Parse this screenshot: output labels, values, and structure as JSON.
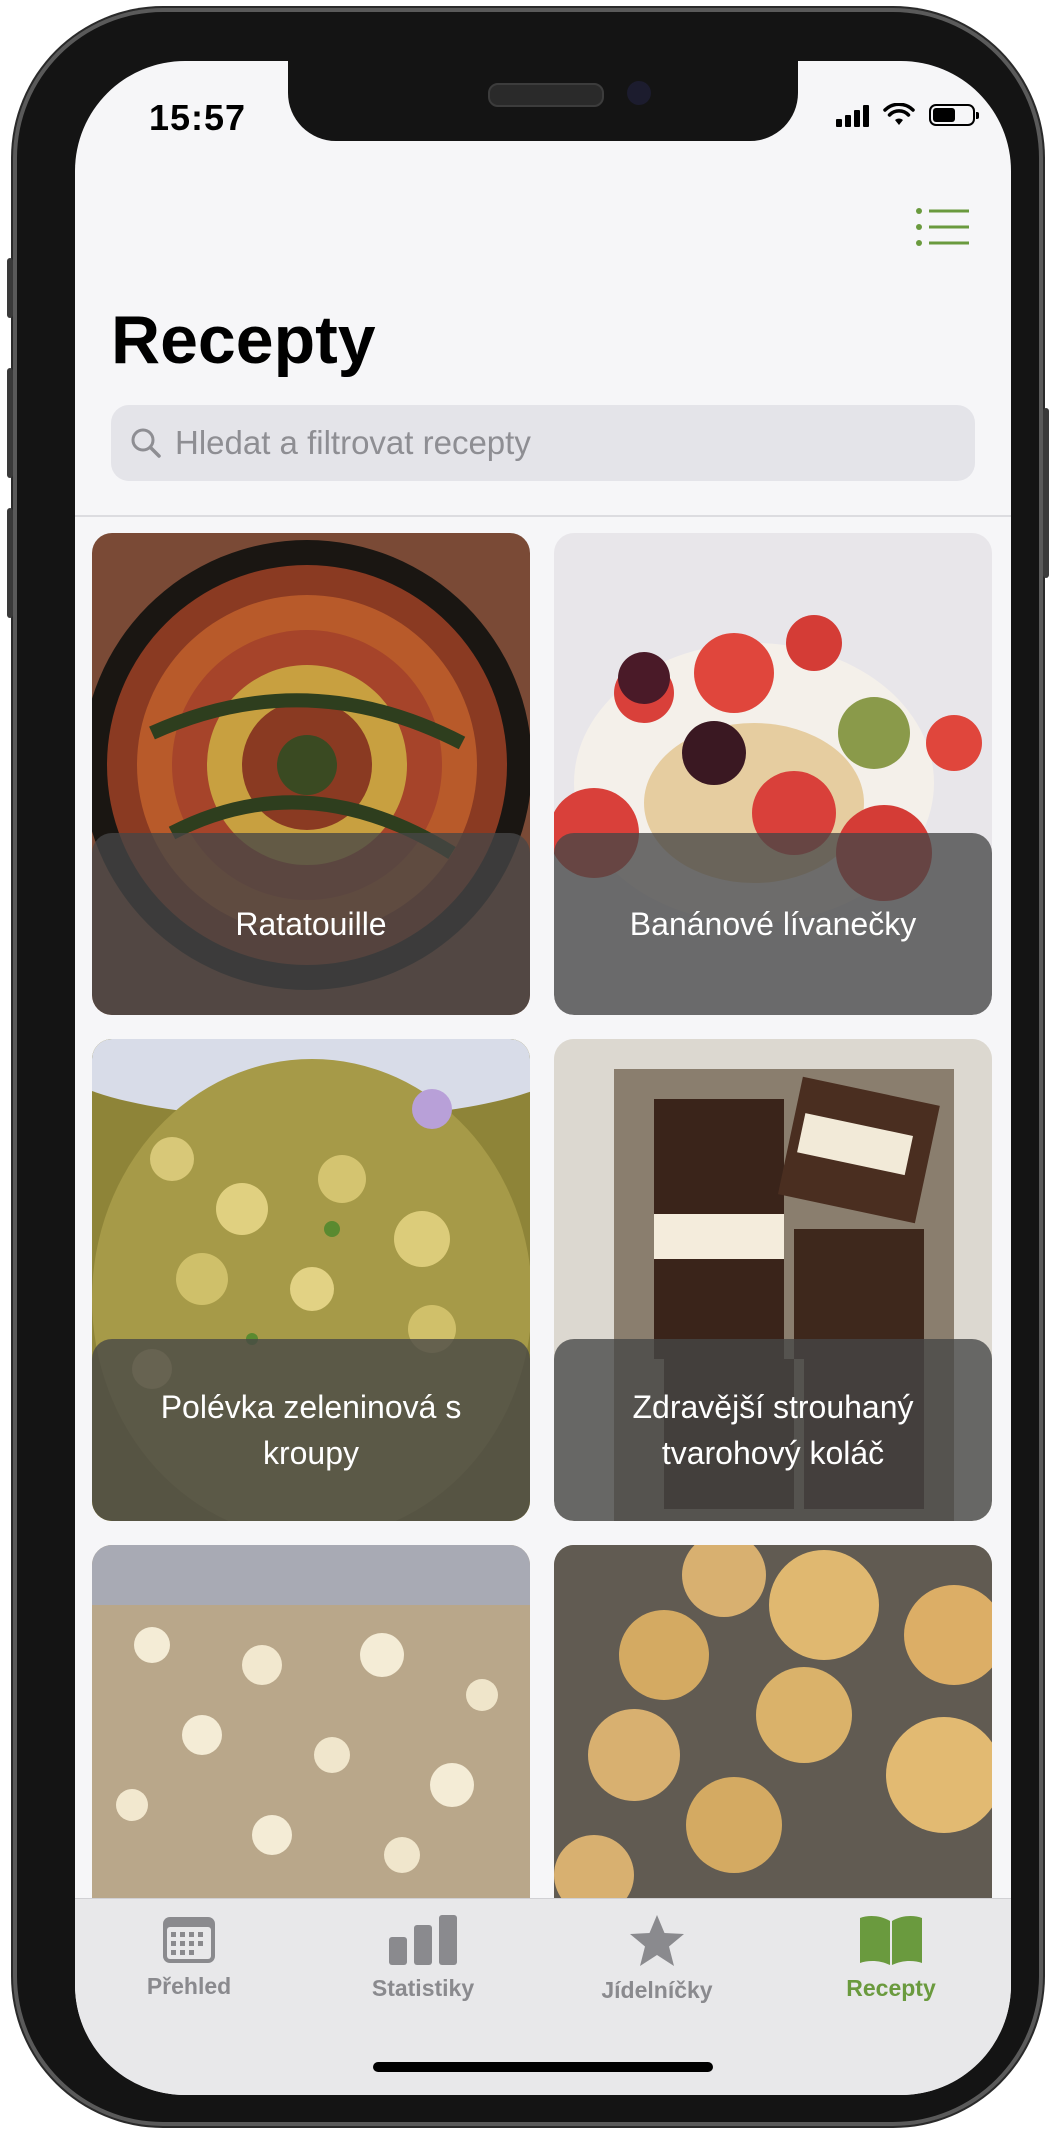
{
  "status_bar": {
    "time": "15:57"
  },
  "header": {
    "title": "Recepty",
    "menu_icon": "list-icon"
  },
  "search": {
    "placeholder": "Hledat a filtrovat recepty",
    "icon": "search-icon"
  },
  "colors": {
    "accent": "#6a9a3e",
    "inactive": "#8a8a8e"
  },
  "recipes": [
    {
      "name": "Ratatouille"
    },
    {
      "name": "Banánové lívanečky"
    },
    {
      "name": "Polévka zeleninová s kroupy"
    },
    {
      "name": "Zdravější strouhaný tvarohový koláč"
    },
    {
      "name": ""
    },
    {
      "name": ""
    }
  ],
  "tabs": [
    {
      "label": "Přehled",
      "icon": "calendar-icon",
      "active": false
    },
    {
      "label": "Statistiky",
      "icon": "bar-chart-icon",
      "active": false
    },
    {
      "label": "Jídelníčky",
      "icon": "star-icon",
      "active": false
    },
    {
      "label": "Recepty",
      "icon": "book-icon",
      "active": true
    }
  ]
}
